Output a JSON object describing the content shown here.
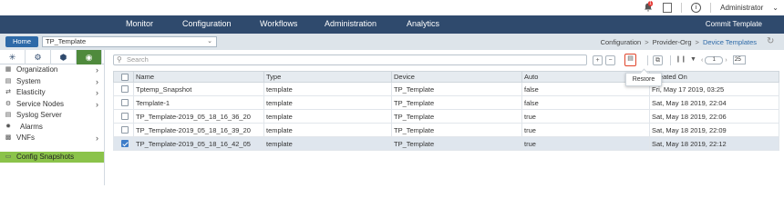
{
  "topbar": {
    "notification_count": "1",
    "user": "Administrator",
    "icons": [
      "bell-icon",
      "document-icon",
      "info-icon",
      "chevron-down-icon"
    ]
  },
  "nav": {
    "items": [
      "Monitor",
      "Configuration",
      "Workflows",
      "Administration",
      "Analytics"
    ],
    "commit_label": "Commit Template"
  },
  "subbar": {
    "home_label": "Home",
    "template_value": "TP_Template",
    "breadcrumb": [
      "Configuration",
      "Provider-Org",
      "Device Templates"
    ]
  },
  "sidebar": {
    "items": [
      {
        "label": "Organization",
        "icon": "org-icon",
        "has_arrow": true
      },
      {
        "label": "System",
        "icon": "system-icon",
        "has_arrow": true
      },
      {
        "label": "Elasticity",
        "icon": "elasticity-icon",
        "has_arrow": true
      },
      {
        "label": "Service Nodes",
        "icon": "service-nodes-icon",
        "has_arrow": true
      },
      {
        "label": "Syslog Server",
        "icon": "syslog-icon",
        "has_arrow": false
      },
      {
        "label": "Alarms",
        "icon": "alarm-icon",
        "has_arrow": false
      },
      {
        "label": "VNFs",
        "icon": "vnf-icon",
        "has_arrow": true
      }
    ],
    "selected": "Config Snapshots",
    "accent": "#8bc34a"
  },
  "toolbar": {
    "search_placeholder": "Search",
    "page": "1",
    "page_size": "25",
    "tooltip": "Restore"
  },
  "table": {
    "columns": [
      "Name",
      "Type",
      "Device",
      "Auto",
      "Created On"
    ],
    "rows": [
      {
        "name": "Tptemp_Snapshot",
        "type": "template",
        "device": "TP_Template",
        "auto": "false",
        "created": "Fri, May 17 2019, 03:25",
        "checked": false
      },
      {
        "name": "Template-1",
        "type": "template",
        "device": "TP_Template",
        "auto": "false",
        "created": "Sat, May 18 2019, 22:04",
        "checked": false
      },
      {
        "name": "TP_Template-2019_05_18_16_36_20",
        "type": "template",
        "device": "TP_Template",
        "auto": "true",
        "created": "Sat, May 18 2019, 22:06",
        "checked": false
      },
      {
        "name": "TP_Template-2019_05_18_16_39_20",
        "type": "template",
        "device": "TP_Template",
        "auto": "true",
        "created": "Sat, May 18 2019, 22:09",
        "checked": false
      },
      {
        "name": "TP_Template-2019_05_18_16_42_05",
        "type": "template",
        "device": "TP_Template",
        "auto": "true",
        "created": "Sat, May 18 2019, 22:12",
        "checked": true
      }
    ]
  },
  "colors": {
    "nav_bg": "#2f4a6d",
    "home_btn": "#2e6aa8",
    "restore_highlight": "#e0442a"
  }
}
